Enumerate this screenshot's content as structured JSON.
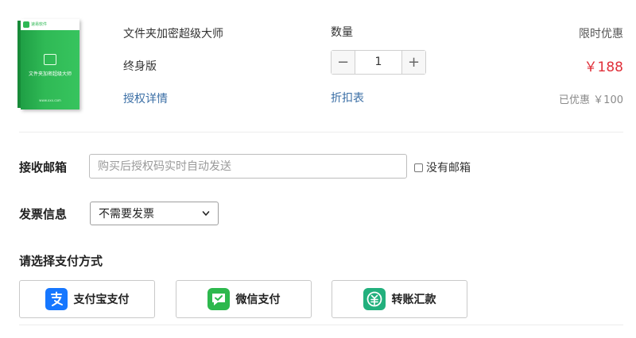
{
  "product": {
    "box_brand": "速易软件",
    "box_title": "文件夹加密超级大师",
    "box_url": "www.xxx.com",
    "name": "文件夹加密超级大师",
    "edition": "终身版",
    "license_link": "授权详情"
  },
  "quantity": {
    "label": "数量",
    "value": "1",
    "minus": "−",
    "plus": "+",
    "discount_link": "折扣表"
  },
  "pricing": {
    "label": "限时优惠",
    "price": "￥188",
    "saved": "已优惠 ￥100",
    "accent_color": "#e0303a"
  },
  "email": {
    "label": "接收邮箱",
    "placeholder": "购买后授权码实时自动发送",
    "value": "",
    "no_email_label": "没有邮箱"
  },
  "invoice": {
    "label": "发票信息",
    "selected": "不需要发票"
  },
  "payment": {
    "label": "请选择支付方式",
    "methods": [
      {
        "name": "支付宝支付",
        "icon": "alipay-icon",
        "color": "#1677ff"
      },
      {
        "name": "微信支付",
        "icon": "wechat-icon",
        "color": "#2db84d"
      },
      {
        "name": "转账汇款",
        "icon": "transfer-icon",
        "color": "#22b07d"
      }
    ]
  }
}
